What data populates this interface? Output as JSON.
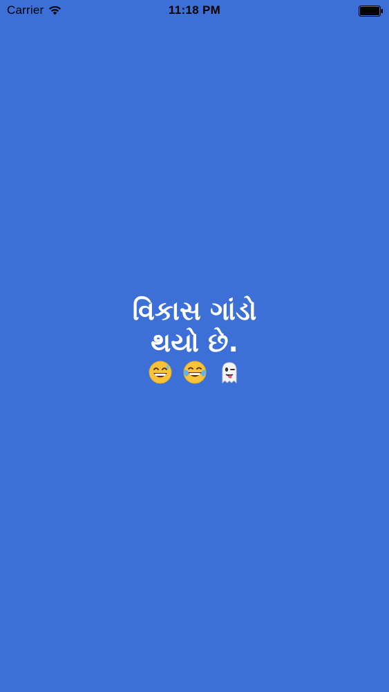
{
  "status_bar": {
    "carrier": "Carrier",
    "time": "11:18 PM"
  },
  "splash": {
    "line1": "વિકાસ ગાંડો",
    "line2": "થયો છે.",
    "emojis": [
      "grinning-face-with-sweat-icon",
      "face-with-tears-of-joy-icon",
      "ghost-icon"
    ]
  },
  "colors": {
    "background": "#3d70d6",
    "text": "#ffffff",
    "status_text": "#000000"
  }
}
